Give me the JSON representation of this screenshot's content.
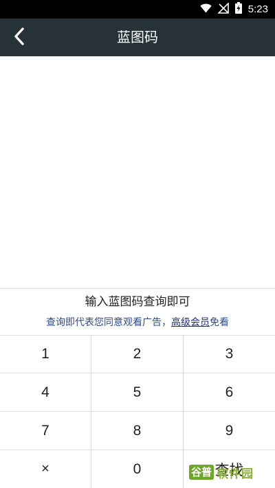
{
  "status_bar": {
    "time": "5:23",
    "icons": [
      "wifi-icon",
      "signal-off-icon",
      "battery-charging-icon"
    ]
  },
  "app_bar": {
    "title": "蓝图码",
    "back_icon": "chevron-left-icon"
  },
  "hint": {
    "text": "输入蓝图码查询即可",
    "notice_prefix": "查询即代表您同意观看广告，",
    "notice_link": "高级会员",
    "notice_suffix": "免看"
  },
  "keypad": {
    "keys": [
      "1",
      "2",
      "3",
      "4",
      "5",
      "6",
      "7",
      "8",
      "9",
      "×",
      "0",
      "查找"
    ]
  },
  "watermark": {
    "logo": "谷普",
    "text": "软件园"
  },
  "colors": {
    "status_bar": "#000000",
    "app_bar": "#263238",
    "notice_text": "#2f4a92",
    "divider": "#dcdcdc"
  }
}
